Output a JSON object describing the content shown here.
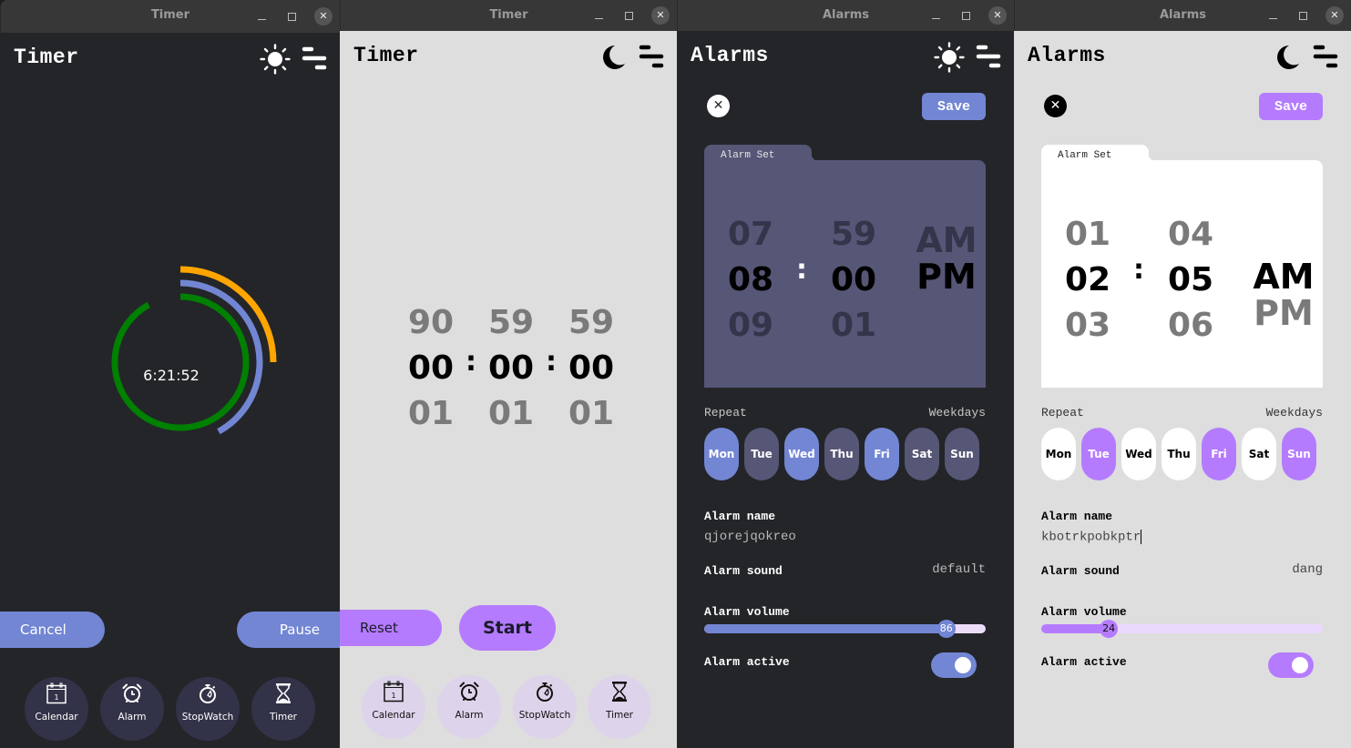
{
  "windows": [
    {
      "window_title": "Timer",
      "theme": "dark",
      "app_title": "Timer",
      "theme_toggle_icon": "sun-icon",
      "timer": {
        "remaining": "6:21:52",
        "rings": [
          {
            "name": "hours-ring",
            "color": "#008000",
            "fraction": 0.92
          },
          {
            "name": "minutes-ring",
            "color": "#7286d3",
            "fraction": 0.42
          },
          {
            "name": "seconds-ring",
            "color": "#ffa500",
            "fraction": 0.25
          }
        ]
      },
      "buttons": {
        "cancel": "Cancel",
        "pause": "Pause"
      },
      "nav": [
        {
          "label": "Calendar",
          "icon": "calendar-icon",
          "day": "1"
        },
        {
          "label": "Alarm",
          "icon": "alarm-clock-icon"
        },
        {
          "label": "StopWatch",
          "icon": "stopwatch-icon"
        },
        {
          "label": "Timer",
          "icon": "hourglass-icon"
        }
      ]
    },
    {
      "window_title": "Timer",
      "theme": "light",
      "app_title": "Timer",
      "theme_toggle_icon": "moon-icon",
      "picker": {
        "hours": {
          "prev": "90",
          "selected": "00",
          "next": "01"
        },
        "minutes": {
          "prev": "59",
          "selected": "00",
          "next": "01"
        },
        "seconds": {
          "prev": "59",
          "selected": "00",
          "next": "01"
        },
        "separator": ":"
      },
      "buttons": {
        "reset": "Reset",
        "start": "Start"
      },
      "nav": [
        {
          "label": "Calendar",
          "icon": "calendar-icon",
          "day": "1"
        },
        {
          "label": "Alarm",
          "icon": "alarm-clock-icon"
        },
        {
          "label": "StopWatch",
          "icon": "stopwatch-icon"
        },
        {
          "label": "Timer",
          "icon": "hourglass-icon"
        }
      ]
    },
    {
      "window_title": "Alarms",
      "theme": "dark",
      "app_title": "Alarms",
      "theme_toggle_icon": "sun-icon",
      "save_label": "Save",
      "card_tab": "Alarm Set",
      "picker": {
        "hours": {
          "prev": "07",
          "selected": "08",
          "next": "09"
        },
        "minutes": {
          "prev": "59",
          "selected": "00",
          "next": "01"
        },
        "separator": ":",
        "ampm": {
          "am": "AM",
          "pm": "PM",
          "selected": "PM"
        }
      },
      "repeat_label": "Repeat",
      "repeat_summary": "Weekdays",
      "days": [
        {
          "label": "Mon",
          "active": true
        },
        {
          "label": "Tue",
          "active": false
        },
        {
          "label": "Wed",
          "active": true
        },
        {
          "label": "Thu",
          "active": false
        },
        {
          "label": "Fri",
          "active": true
        },
        {
          "label": "Sat",
          "active": false
        },
        {
          "label": "Sun",
          "active": false
        }
      ],
      "name_label": "Alarm name",
      "name_value": "qjorejqokreo",
      "sound_label": "Alarm sound",
      "sound_value": "default",
      "volume_label": "Alarm volume",
      "volume_value": 86,
      "active_label": "Alarm active",
      "active": true,
      "colors": {
        "accent": "#7286d3",
        "inactive_day": "#565676"
      }
    },
    {
      "window_title": "Alarms",
      "theme": "light",
      "app_title": "Alarms",
      "theme_toggle_icon": "moon-icon",
      "save_label": "Save",
      "card_tab": "Alarm Set",
      "picker": {
        "hours": {
          "prev": "01",
          "selected": "02",
          "next": "03"
        },
        "minutes": {
          "prev": "04",
          "selected": "05",
          "next": "06"
        },
        "separator": ":",
        "ampm": {
          "am": "AM",
          "pm": "PM",
          "selected": "AM"
        }
      },
      "repeat_label": "Repeat",
      "repeat_summary": "Weekdays",
      "days": [
        {
          "label": "Mon",
          "active": false
        },
        {
          "label": "Tue",
          "active": true
        },
        {
          "label": "Wed",
          "active": false
        },
        {
          "label": "Thu",
          "active": false
        },
        {
          "label": "Fri",
          "active": true
        },
        {
          "label": "Sat",
          "active": false
        },
        {
          "label": "Sun",
          "active": true
        }
      ],
      "name_label": "Alarm name",
      "name_value": "kbotrkpobkptr",
      "sound_label": "Alarm sound",
      "sound_value": "dang",
      "volume_label": "Alarm volume",
      "volume_value": 24,
      "active_label": "Alarm active",
      "active": true,
      "colors": {
        "accent": "#b57bff",
        "inactive_day": "#ffffff"
      }
    }
  ],
  "titlebar_controls": {
    "minimize": "minimize-icon",
    "maximize": "maximize-icon",
    "close": "close-icon"
  }
}
